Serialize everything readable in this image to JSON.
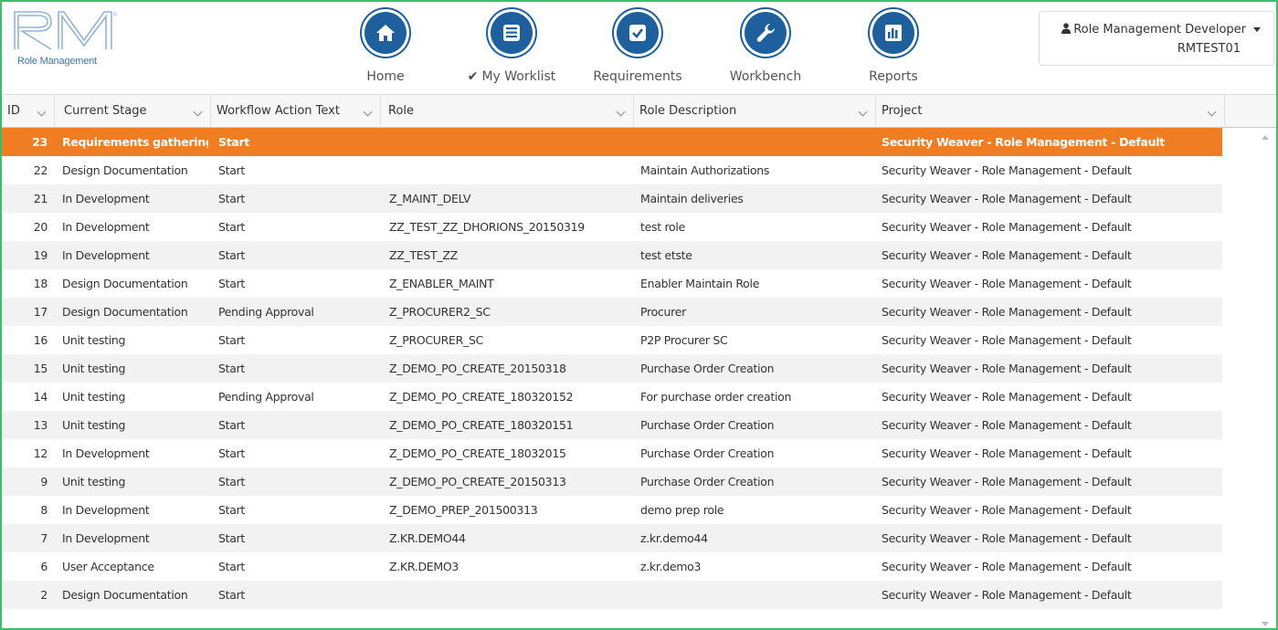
{
  "logo": {
    "mark": "RM",
    "subtitle": "Role Management"
  },
  "nav": {
    "items": [
      {
        "label": "Home",
        "icon": "home-icon"
      },
      {
        "label": "My Worklist",
        "icon": "list-icon",
        "check": "✔"
      },
      {
        "label": "Requirements",
        "icon": "checkbox-icon"
      },
      {
        "label": "Workbench",
        "icon": "wrench-icon"
      },
      {
        "label": "Reports",
        "icon": "bar-chart-icon"
      }
    ]
  },
  "user": {
    "name": "Role Management Developer",
    "id": "RMTEST01",
    "icon": "user-icon"
  },
  "colors": {
    "accent": "#1e5f9e",
    "selected_row": "#f07d22",
    "frame": "#3bbf6a"
  },
  "grid": {
    "columns": [
      "ID",
      "Current Stage",
      "Workflow Action Text",
      "Role",
      "Role Description",
      "Project"
    ],
    "rows": [
      {
        "id": "23",
        "stage": "Requirements gathering",
        "action": "Start",
        "role": "",
        "desc": "",
        "project": "Security Weaver - Role Management - Default",
        "selected": true
      },
      {
        "id": "22",
        "stage": "Design Documentation",
        "action": "Start",
        "role": "",
        "desc": "Maintain Authorizations",
        "project": "Security Weaver - Role Management - Default"
      },
      {
        "id": "21",
        "stage": "In Development",
        "action": "Start",
        "role": "Z_MAINT_DELV",
        "desc": "Maintain deliveries",
        "project": "Security Weaver - Role Management - Default"
      },
      {
        "id": "20",
        "stage": "In Development",
        "action": "Start",
        "role": "ZZ_TEST_ZZ_DHORIONS_20150319",
        "desc": "test role",
        "project": "Security Weaver - Role Management - Default"
      },
      {
        "id": "19",
        "stage": "In Development",
        "action": "Start",
        "role": "ZZ_TEST_ZZ",
        "desc": "test etste",
        "project": "Security Weaver - Role Management - Default"
      },
      {
        "id": "18",
        "stage": "Design Documentation",
        "action": "Start",
        "role": "Z_ENABLER_MAINT",
        "desc": "Enabler Maintain Role",
        "project": "Security Weaver - Role Management - Default"
      },
      {
        "id": "17",
        "stage": "Design Documentation",
        "action": "Pending Approval",
        "role": "Z_PROCURER2_SC",
        "desc": "Procurer",
        "project": "Security Weaver - Role Management - Default"
      },
      {
        "id": "16",
        "stage": "Unit testing",
        "action": "Start",
        "role": "Z_PROCURER_SC",
        "desc": "P2P Procurer SC",
        "project": "Security Weaver - Role Management - Default"
      },
      {
        "id": "15",
        "stage": "Unit testing",
        "action": "Start",
        "role": "Z_DEMO_PO_CREATE_20150318",
        "desc": "Purchase Order Creation",
        "project": "Security Weaver - Role Management - Default"
      },
      {
        "id": "14",
        "stage": "Unit testing",
        "action": "Pending Approval",
        "role": "Z_DEMO_PO_CREATE_180320152",
        "desc": "For purchase order creation",
        "project": "Security Weaver - Role Management - Default"
      },
      {
        "id": "13",
        "stage": "Unit testing",
        "action": "Start",
        "role": "Z_DEMO_PO_CREATE_180320151",
        "desc": "Purchase Order Creation",
        "project": "Security Weaver - Role Management - Default"
      },
      {
        "id": "12",
        "stage": "In Development",
        "action": "Start",
        "role": "Z_DEMO_PO_CREATE_18032015",
        "desc": "Purchase Order Creation",
        "project": "Security Weaver - Role Management - Default"
      },
      {
        "id": "9",
        "stage": "Unit testing",
        "action": "Start",
        "role": "Z_DEMO_PO_CREATE_20150313",
        "desc": "Purchase Order Creation",
        "project": "Security Weaver - Role Management - Default"
      },
      {
        "id": "8",
        "stage": "In Development",
        "action": "Start",
        "role": "Z_DEMO_PREP_201500313",
        "desc": "demo prep role",
        "project": "Security Weaver - Role Management - Default"
      },
      {
        "id": "7",
        "stage": "In Development",
        "action": "Start",
        "role": "Z.KR.DEMO44",
        "desc": "z.kr.demo44",
        "project": "Security Weaver - Role Management - Default"
      },
      {
        "id": "6",
        "stage": "User Acceptance",
        "action": "Start",
        "role": "Z.KR.DEMO3",
        "desc": "z.kr.demo3",
        "project": "Security Weaver - Role Management - Default"
      },
      {
        "id": "2",
        "stage": "Design Documentation",
        "action": "Start",
        "role": "",
        "desc": "",
        "project": "Security Weaver - Role Management - Default"
      }
    ]
  }
}
